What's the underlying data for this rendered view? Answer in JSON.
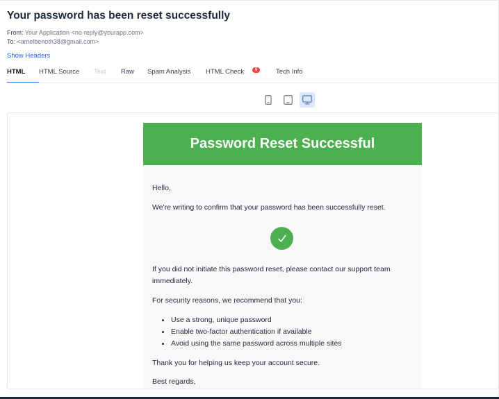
{
  "message": {
    "subject": "Your password has been reset successfully",
    "from_label": "From:",
    "from_value": "Your Application <no-reply@yourapp.com>",
    "to_label": "To:",
    "to_value": "<amelbenoth38@gmail.com>",
    "show_headers": "Show Headers"
  },
  "tabs": [
    {
      "label": "HTML",
      "active": true
    },
    {
      "label": "HTML Source"
    },
    {
      "label": "Text",
      "disabled": true
    },
    {
      "label": "Raw"
    },
    {
      "label": "Spam Analysis"
    },
    {
      "label": "HTML Check",
      "badge": "5"
    },
    {
      "label": "Tech Info"
    }
  ],
  "devices": [
    {
      "icon": "mobile-icon"
    },
    {
      "icon": "tablet-icon"
    },
    {
      "icon": "desktop-icon",
      "active": true
    }
  ],
  "email": {
    "header_title": "Password Reset Successful",
    "greeting": "Hello,",
    "confirm_text": "We're writing to confirm that your password has been successfully reset.",
    "check_icon": "check-circle-icon",
    "initiate_text": "If you did not initiate this password reset, please contact our support team immediately.",
    "security_text": "For security reasons, we recommend that you:",
    "tips": [
      "Use a strong, unique password",
      "Enable two-factor authentication if available",
      "Avoid using the same password across multiple sites"
    ],
    "thanks_text": "Thank you for helping us keep your account secure.",
    "regards_text": "Best regards,"
  },
  "colors": {
    "accent_blue": "#3b82f6",
    "email_green": "#4caf50",
    "badge_red": "#ef4444"
  }
}
